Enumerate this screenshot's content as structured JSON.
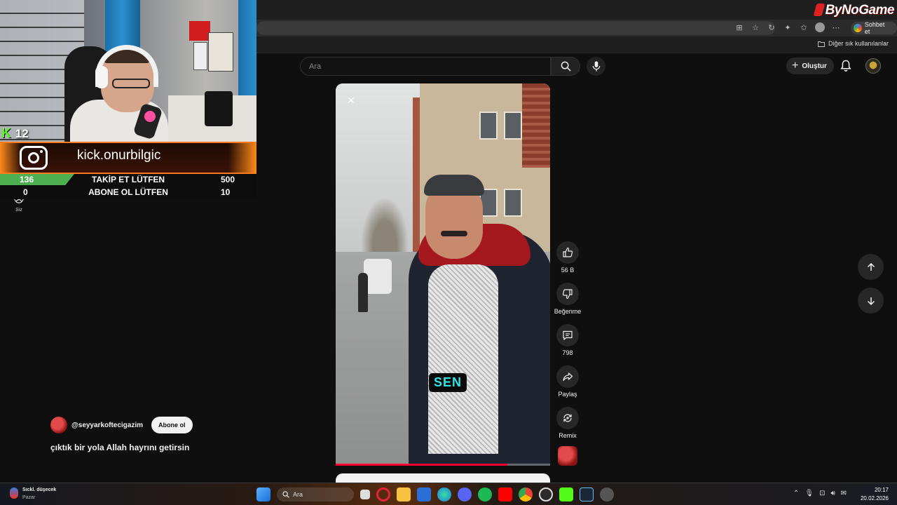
{
  "browser": {
    "brand": "ByNoGame",
    "chat_button": "Sohbet et",
    "bookmarks_other": "Diğer sık kullanılanlar"
  },
  "youtube": {
    "search_placeholder": "Ara",
    "create_label": "Oluştur",
    "nav_you_label": "Siz",
    "video": {
      "overlay_text": "SEN",
      "progress_fraction": 0.8
    },
    "channel": {
      "handle": "@seyyarkoftecigazim",
      "subscribe_label": "Abone ol"
    },
    "title": "çıktık bir yola Allah hayrını getirsin",
    "actions": [
      {
        "name": "like",
        "label": "56 B"
      },
      {
        "name": "dislike",
        "label": "Beğenme"
      },
      {
        "name": "comments",
        "label": "798"
      },
      {
        "name": "share",
        "label": "Paylaş"
      },
      {
        "name": "remix",
        "label": "Remix"
      }
    ]
  },
  "stream_overlay": {
    "kick_count": "12",
    "banner_text": "kick.onurbilgic",
    "goals": [
      {
        "current": "136",
        "label": "TAKİP ET LÜTFEN",
        "target": "500",
        "fraction": 0.272
      },
      {
        "current": "0",
        "label": "ABONE OL LÜTFEN",
        "target": "10",
        "fraction": 0
      }
    ]
  },
  "taskbar": {
    "weather_title": "Sıckl. düşecek",
    "weather_sub": "Pazar",
    "search_placeholder": "Ara",
    "time": "20:17",
    "date": "20.02.2026"
  }
}
